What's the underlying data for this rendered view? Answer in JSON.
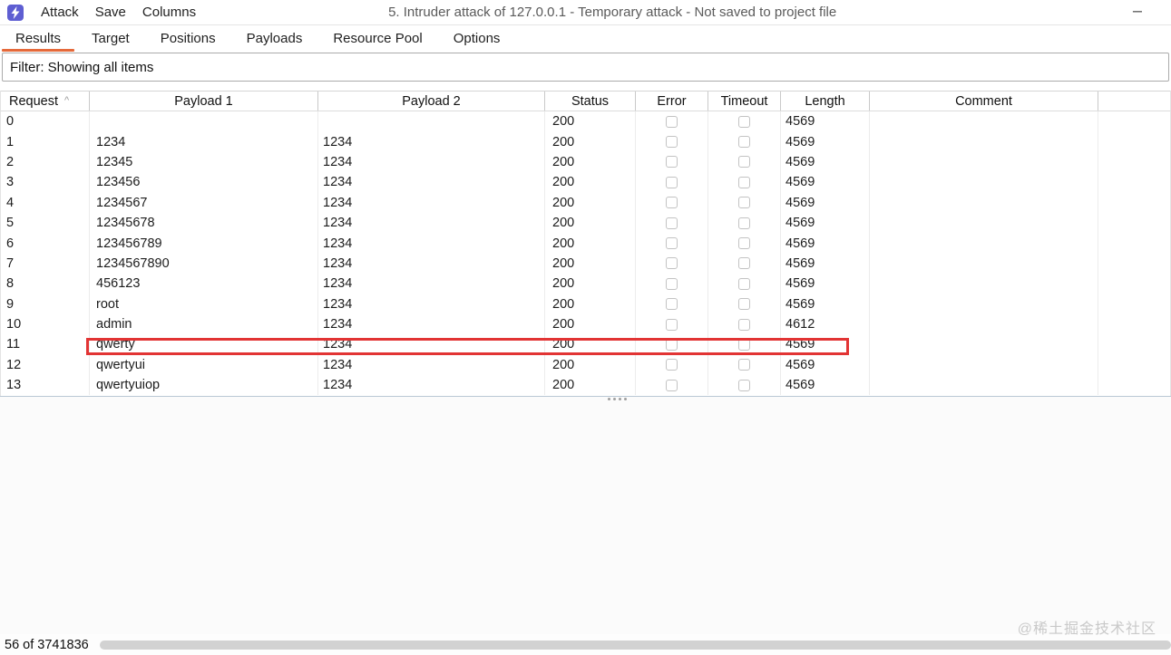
{
  "window": {
    "title": "5. Intruder attack of 127.0.0.1 - Temporary attack - Not saved to project file",
    "menu": [
      "Attack",
      "Save",
      "Columns"
    ],
    "minimize_glyph": "─",
    "app_icon": "intruder-lightning-icon"
  },
  "tabs": [
    {
      "label": "Results",
      "active": true
    },
    {
      "label": "Target",
      "active": false
    },
    {
      "label": "Positions",
      "active": false
    },
    {
      "label": "Payloads",
      "active": false
    },
    {
      "label": "Resource Pool",
      "active": false
    },
    {
      "label": "Options",
      "active": false
    }
  ],
  "filter": {
    "text": "Filter: Showing all items"
  },
  "table": {
    "columns": [
      "Request",
      "Payload 1",
      "Payload 2",
      "Status",
      "Error",
      "Timeout",
      "Length",
      "Comment"
    ],
    "sort": {
      "column": "Request",
      "direction": "asc",
      "glyph": "^"
    },
    "rows": [
      {
        "request": "0",
        "payload1": "",
        "payload2": "",
        "status": "200",
        "error": false,
        "timeout": false,
        "length": "4569",
        "comment": ""
      },
      {
        "request": "1",
        "payload1": "1234",
        "payload2": "1234",
        "status": "200",
        "error": false,
        "timeout": false,
        "length": "4569",
        "comment": ""
      },
      {
        "request": "2",
        "payload1": "12345",
        "payload2": "1234",
        "status": "200",
        "error": false,
        "timeout": false,
        "length": "4569",
        "comment": ""
      },
      {
        "request": "3",
        "payload1": "123456",
        "payload2": "1234",
        "status": "200",
        "error": false,
        "timeout": false,
        "length": "4569",
        "comment": ""
      },
      {
        "request": "4",
        "payload1": "1234567",
        "payload2": "1234",
        "status": "200",
        "error": false,
        "timeout": false,
        "length": "4569",
        "comment": ""
      },
      {
        "request": "5",
        "payload1": "12345678",
        "payload2": "1234",
        "status": "200",
        "error": false,
        "timeout": false,
        "length": "4569",
        "comment": ""
      },
      {
        "request": "6",
        "payload1": "123456789",
        "payload2": "1234",
        "status": "200",
        "error": false,
        "timeout": false,
        "length": "4569",
        "comment": ""
      },
      {
        "request": "7",
        "payload1": "1234567890",
        "payload2": "1234",
        "status": "200",
        "error": false,
        "timeout": false,
        "length": "4569",
        "comment": ""
      },
      {
        "request": "8",
        "payload1": "456123",
        "payload2": "1234",
        "status": "200",
        "error": false,
        "timeout": false,
        "length": "4569",
        "comment": ""
      },
      {
        "request": "9",
        "payload1": "root",
        "payload2": "1234",
        "status": "200",
        "error": false,
        "timeout": false,
        "length": "4569",
        "comment": ""
      },
      {
        "request": "10",
        "payload1": "admin",
        "payload2": "1234",
        "status": "200",
        "error": false,
        "timeout": false,
        "length": "4612",
        "comment": "",
        "highlighted": true
      },
      {
        "request": "11",
        "payload1": "qwerty",
        "payload2": "1234",
        "status": "200",
        "error": false,
        "timeout": false,
        "length": "4569",
        "comment": ""
      },
      {
        "request": "12",
        "payload1": "qwertyui",
        "payload2": "1234",
        "status": "200",
        "error": false,
        "timeout": false,
        "length": "4569",
        "comment": ""
      },
      {
        "request": "13",
        "payload1": "qwertyuiop",
        "payload2": "1234",
        "status": "200",
        "error": false,
        "timeout": false,
        "length": "4569",
        "comment": ""
      }
    ],
    "annotation": {
      "type": "red-rectangle",
      "row_request": "10"
    }
  },
  "statusbar": {
    "text": "56 of 3741836",
    "progress_percent": 0
  },
  "watermark": {
    "text": "@稀土掘金技术社区"
  },
  "colors": {
    "accent": "#e5693a",
    "icon_bg": "#5e5ed2",
    "highlight_border": "#e23434",
    "progress_track": "#d2d2d2"
  }
}
